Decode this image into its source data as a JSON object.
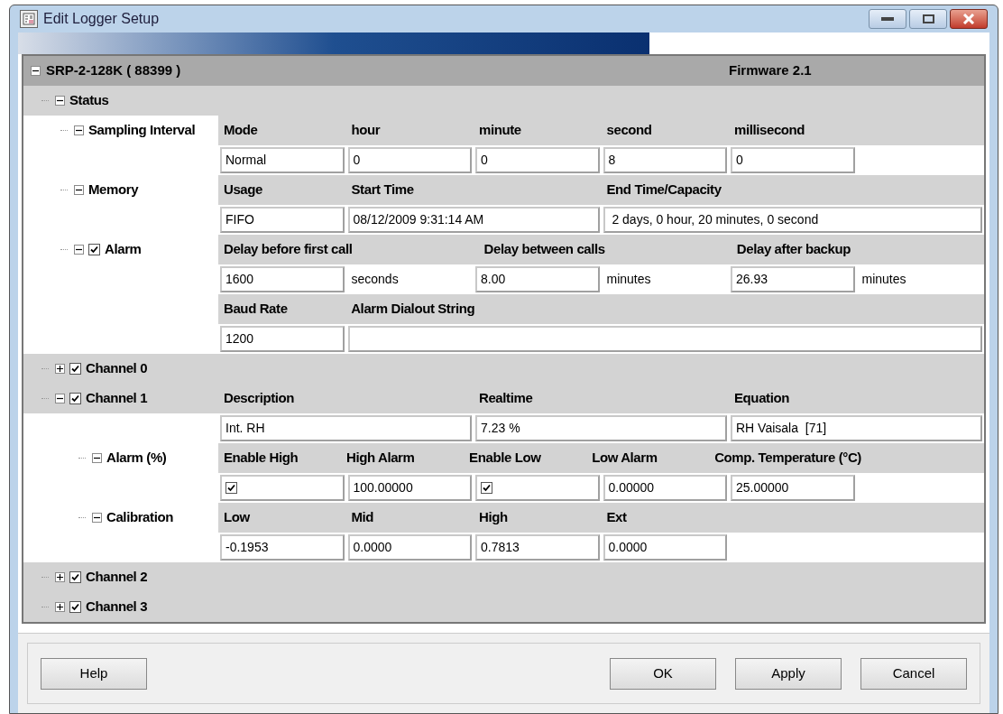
{
  "window": {
    "title": "Edit Logger Setup"
  },
  "device": {
    "name": "SRP-2-128K ( 88399 )",
    "firmware": "Firmware 2.1",
    "expanded": true
  },
  "tree": [
    {
      "kind": "group",
      "label": "Status",
      "expanded": true,
      "children": [
        {
          "kind": "section",
          "label": "Sampling Interval",
          "expanded": true,
          "rows": [
            [
              {
                "kind": "header",
                "text": "Mode"
              },
              {
                "kind": "header",
                "text": "hour"
              },
              {
                "kind": "header",
                "text": "minute"
              },
              {
                "kind": "header",
                "text": "second"
              },
              {
                "kind": "header",
                "text": "millisecond"
              }
            ],
            [
              {
                "kind": "input",
                "value": "Normal"
              },
              {
                "kind": "input",
                "value": "0"
              },
              {
                "kind": "input",
                "value": "0"
              },
              {
                "kind": "input",
                "value": "8"
              },
              {
                "kind": "input",
                "value": "0"
              }
            ]
          ]
        },
        {
          "kind": "section",
          "label": "Memory",
          "expanded": true,
          "rows": [
            [
              {
                "kind": "header",
                "text": "Usage"
              },
              {
                "kind": "header",
                "text": "Start Time"
              },
              {
                "kind": "blank"
              },
              {
                "kind": "header",
                "text": "End Time/Capacity"
              },
              {
                "kind": "blank"
              },
              {
                "kind": "blank"
              }
            ],
            [
              {
                "kind": "input",
                "value": "FIFO"
              },
              {
                "kind": "input",
                "value": "08/12/2009 9:31:14 AM"
              },
              {
                "kind": "blank"
              },
              {
                "kind": "input",
                "value": " 2 days, 0 hour, 20 minutes, 0 second"
              },
              {
                "kind": "blank"
              },
              {
                "kind": "blank"
              }
            ]
          ]
        },
        {
          "kind": "section",
          "label": "Alarm",
          "expanded": true,
          "checked": true,
          "rows": [
            [
              {
                "kind": "header",
                "text": "Delay before first call"
              },
              {
                "kind": "blank"
              },
              {
                "kind": "header",
                "text": "Delay between calls"
              },
              {
                "kind": "blank"
              },
              {
                "kind": "header",
                "text": "Delay after backup"
              },
              {
                "kind": "blank"
              }
            ],
            [
              {
                "kind": "input",
                "value": "1600"
              },
              {
                "kind": "text",
                "value": "seconds"
              },
              {
                "kind": "input",
                "value": "8.00"
              },
              {
                "kind": "text",
                "value": "minutes"
              },
              {
                "kind": "input",
                "value": "26.93"
              },
              {
                "kind": "text",
                "value": "minutes"
              }
            ],
            [
              {
                "kind": "header",
                "text": "Baud Rate"
              },
              {
                "kind": "header",
                "text": "Alarm Dialout String"
              },
              {
                "kind": "blank"
              },
              {
                "kind": "blank"
              },
              {
                "kind": "blank"
              },
              {
                "kind": "blank"
              }
            ],
            [
              {
                "kind": "input",
                "value": "1200"
              },
              {
                "kind": "input"
              },
              {
                "kind": "blank"
              },
              {
                "kind": "blank"
              },
              {
                "kind": "blank"
              },
              {
                "kind": "blank"
              }
            ]
          ]
        }
      ]
    },
    {
      "kind": "group",
      "label": "Channel 0",
      "expanded": false,
      "checked": true
    },
    {
      "kind": "group",
      "label": "Channel 1",
      "expanded": true,
      "checked": true,
      "rows": [
        [
          {
            "kind": "header",
            "text": "Description"
          },
          {
            "kind": "blank"
          },
          {
            "kind": "header",
            "text": "Realtime"
          },
          {
            "kind": "blank"
          },
          {
            "kind": "header",
            "text": "Equation"
          },
          {
            "kind": "blank"
          }
        ],
        [
          {
            "kind": "input",
            "value": "Int. RH"
          },
          {
            "kind": "blank"
          },
          {
            "kind": "input",
            "value": "7.23 %"
          },
          {
            "kind": "blank"
          },
          {
            "kind": "input",
            "value": "RH Vaisala  [71]"
          },
          {
            "kind": "blank"
          }
        ]
      ],
      "children": [
        {
          "kind": "section",
          "label": "Alarm (%)",
          "expanded": true,
          "rows": [
            [
              {
                "kind": "header",
                "text": "Enable High"
              },
              {
                "kind": "header",
                "text": "High Alarm"
              },
              {
                "kind": "header",
                "text": "Enable Low"
              },
              {
                "kind": "header",
                "text": "Low Alarm"
              },
              {
                "kind": "header",
                "text": "Comp. Temperature (°C)"
              }
            ],
            [
              {
                "kind": "checkbox",
                "checked": true
              },
              {
                "kind": "input",
                "value": "100.00000"
              },
              {
                "kind": "checkbox",
                "checked": true
              },
              {
                "kind": "input",
                "value": "0.00000"
              },
              {
                "kind": "input",
                "value": "25.00000"
              }
            ]
          ]
        },
        {
          "kind": "section",
          "label": "Calibration",
          "expanded": true,
          "rows": [
            [
              {
                "kind": "header",
                "text": "Low"
              },
              {
                "kind": "header",
                "text": "Mid"
              },
              {
                "kind": "header",
                "text": "High"
              },
              {
                "kind": "header",
                "text": "Ext"
              }
            ],
            [
              {
                "kind": "input",
                "value": "-0.1953"
              },
              {
                "kind": "input",
                "value": "0.0000"
              },
              {
                "kind": "input",
                "value": "0.7813"
              },
              {
                "kind": "input",
                "value": "0.0000"
              }
            ]
          ]
        }
      ]
    },
    {
      "kind": "group",
      "label": "Channel 2",
      "expanded": false,
      "checked": true
    },
    {
      "kind": "group",
      "label": "Channel 3",
      "expanded": false,
      "checked": true
    }
  ],
  "buttons": {
    "help": "Help",
    "actions": [
      "OK",
      "Apply",
      "Cancel"
    ]
  }
}
